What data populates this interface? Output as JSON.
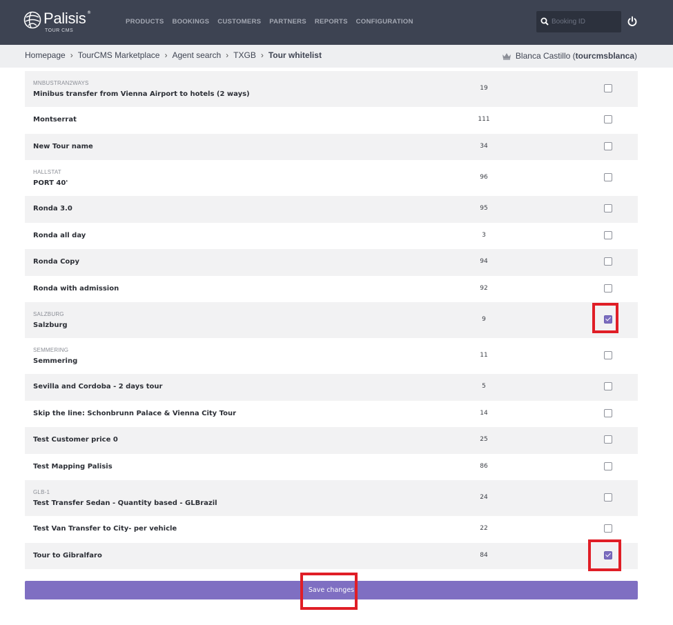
{
  "brand": {
    "name": "Palisis",
    "sub": "TOUR CMS",
    "sup": "®"
  },
  "nav": [
    "PRODUCTS",
    "BOOKINGS",
    "CUSTOMERS",
    "PARTNERS",
    "REPORTS",
    "CONFIGURATION"
  ],
  "search": {
    "placeholder": "Booking ID",
    "value": ""
  },
  "breadcrumb": [
    "Homepage",
    "TourCMS Marketplace",
    "Agent search",
    "TXGB"
  ],
  "breadcrumb_current": "Tour whitelist",
  "user": {
    "name": "Blanca Castillo",
    "login": "tourcmsblanca"
  },
  "rows": [
    {
      "code": "MNBUSTRAN2WAYS",
      "name": "Minibus transfer from Vienna Airport to hotels (2 ways)",
      "count": "19",
      "checked": false
    },
    {
      "code": "",
      "name": "Montserrat",
      "count": "111",
      "checked": false
    },
    {
      "code": "",
      "name": "New Tour name",
      "count": "34",
      "checked": false
    },
    {
      "code": "HALLSTAT",
      "name": "PORT 40'",
      "count": "96",
      "checked": false
    },
    {
      "code": "",
      "name": "Ronda 3.0",
      "count": "95",
      "checked": false
    },
    {
      "code": "",
      "name": "Ronda all day",
      "count": "3",
      "checked": false
    },
    {
      "code": "",
      "name": "Ronda Copy",
      "count": "94",
      "checked": false
    },
    {
      "code": "",
      "name": "Ronda with admission",
      "count": "92",
      "checked": false
    },
    {
      "code": "SALZBURG",
      "name": "Salzburg",
      "count": "9",
      "checked": true
    },
    {
      "code": "SEMMERING",
      "name": "Semmering",
      "count": "11",
      "checked": false
    },
    {
      "code": "",
      "name": "Sevilla and Cordoba - 2 days tour",
      "count": "5",
      "checked": false
    },
    {
      "code": "",
      "name": "Skip the line: Schonbrunn Palace & Vienna City Tour",
      "count": "14",
      "checked": false
    },
    {
      "code": "",
      "name": "Test Customer price 0",
      "count": "25",
      "checked": false
    },
    {
      "code": "",
      "name": "Test Mapping Palisis",
      "count": "86",
      "checked": false
    },
    {
      "code": "GLB-1",
      "name": "Test Transfer Sedan - Quantity based - GLBrazil",
      "count": "24",
      "checked": false
    },
    {
      "code": "",
      "name": "Test Van Transfer to City- per vehicle",
      "count": "22",
      "checked": false
    },
    {
      "code": "",
      "name": "Tour to Gibralfaro",
      "count": "84",
      "checked": true
    }
  ],
  "save_label": "Save changes",
  "colors": {
    "header": "#3d4352",
    "accent": "#7f6fc2",
    "highlight": "#e01e26"
  }
}
